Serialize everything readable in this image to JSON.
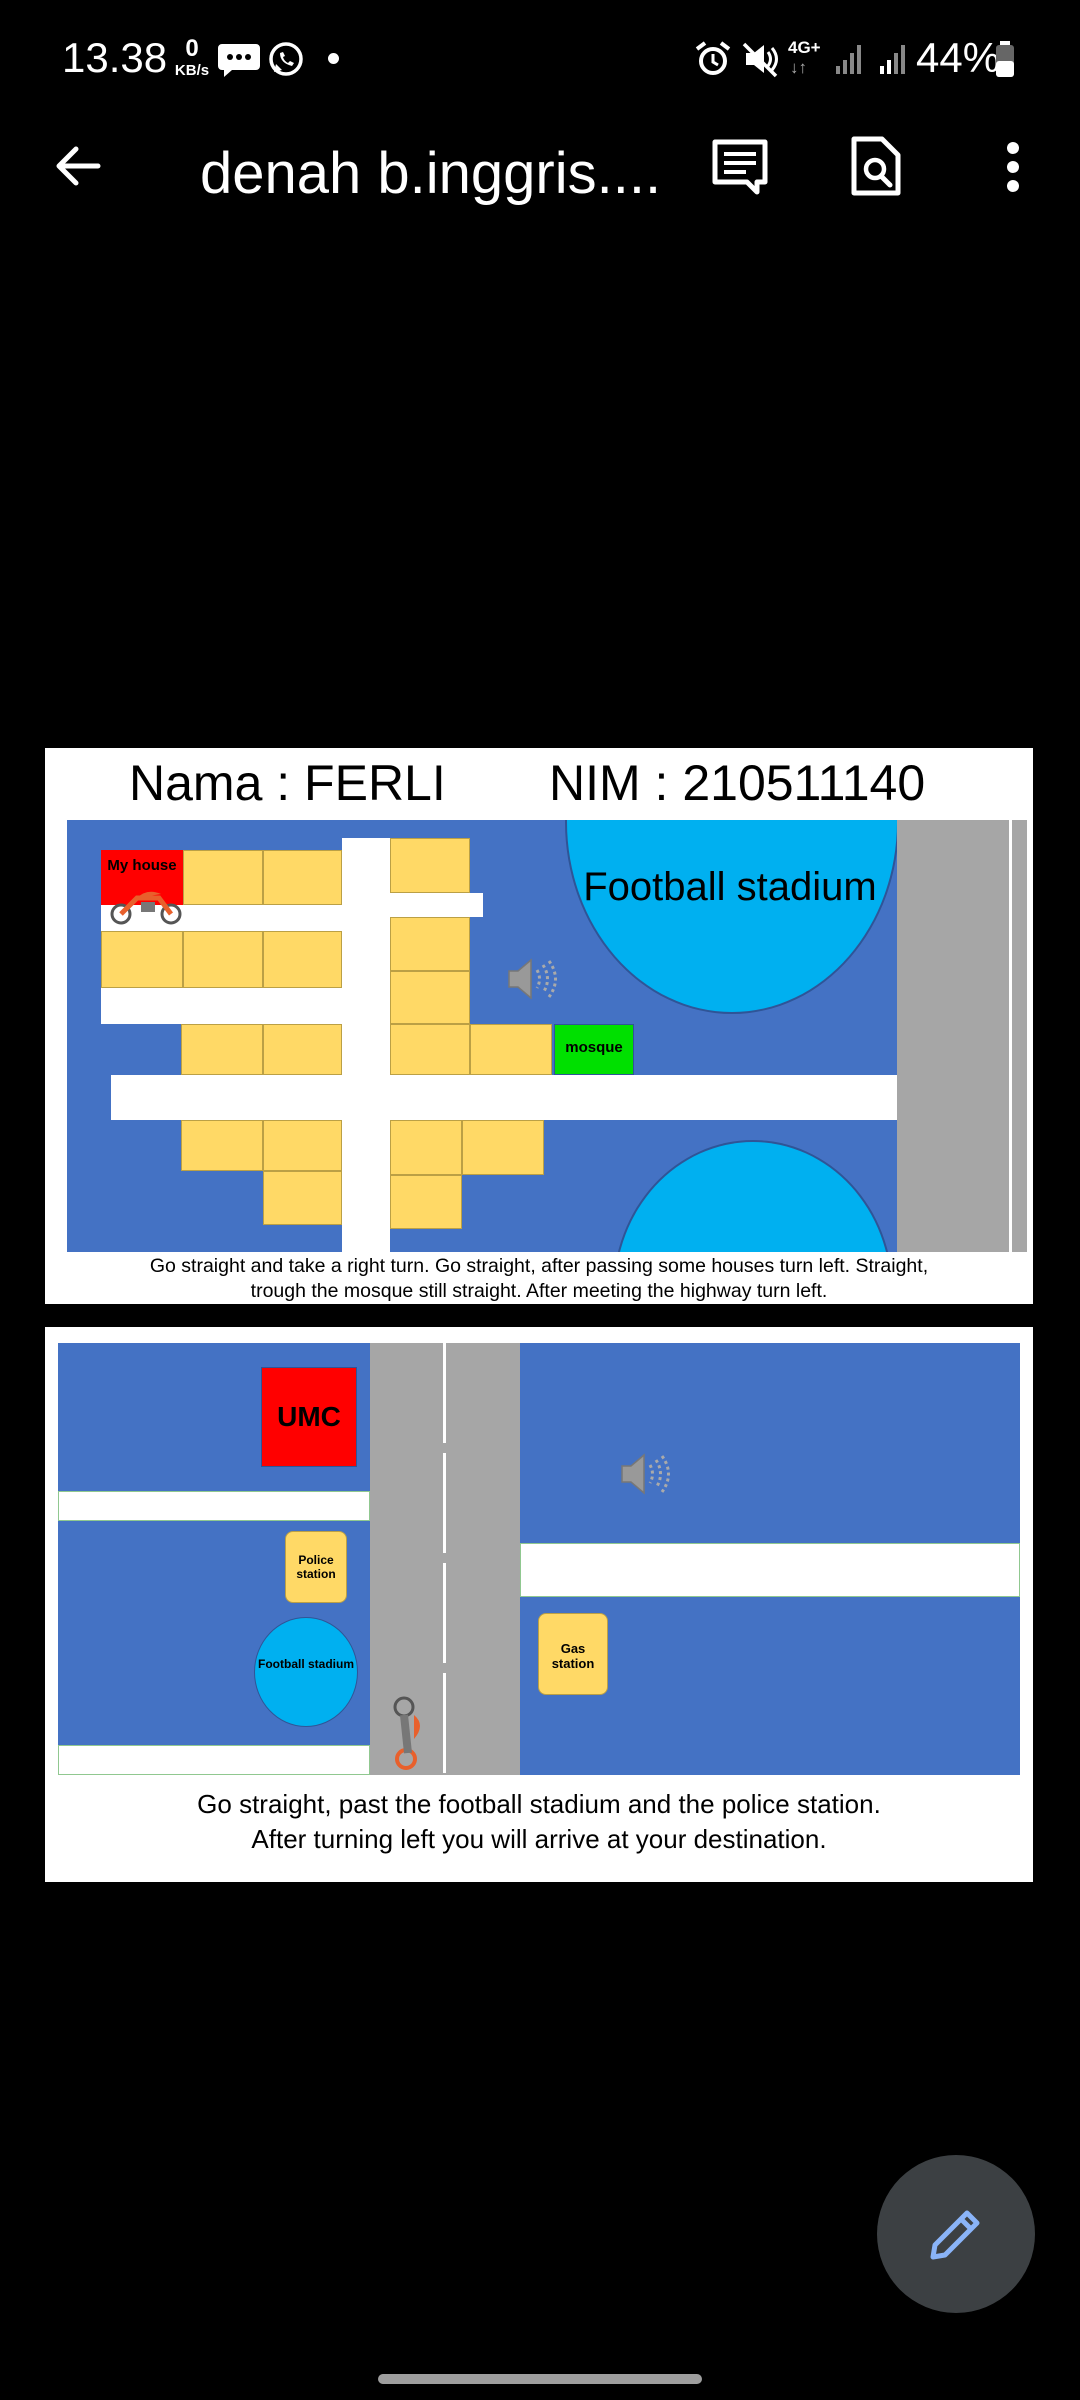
{
  "status_bar": {
    "time": "13.38",
    "data_rate_value": "0",
    "data_rate_unit": "KB/s",
    "network": "4G+",
    "battery": "44%"
  },
  "app_bar": {
    "title": "denah b.inggris...."
  },
  "slide1": {
    "name_label": "Nama : FERLI",
    "nim_label": "NIM : 210511140",
    "my_house": "My house",
    "stadium": "Football stadium",
    "mosque": "mosque",
    "caption_line1": "Go straight and take a right turn. Go straight, after passing some houses turn left. Straight,",
    "caption_line2": "trough the mosque still straight. After meeting the highway turn left."
  },
  "slide2": {
    "umc": "UMC",
    "police": "Police station",
    "stadium": "Football stadium",
    "gas": "Gas station",
    "caption_line1": "Go straight, past the football stadium and the police station.",
    "caption_line2": "After turning left you will arrive at your destination."
  },
  "colors": {
    "map_blue": "#4472c4",
    "stadium_blue": "#00b0f0",
    "house_yellow": "#ffd966",
    "mosque_green": "#00e000",
    "house_red": "#ff0000",
    "highway_gray": "#a6a6a6"
  },
  "icons": [
    "back-arrow-icon",
    "comment-icon",
    "search-document-icon",
    "more-vert-icon",
    "edit-pencil-icon",
    "speaker-icon",
    "motorcycle-icon"
  ]
}
